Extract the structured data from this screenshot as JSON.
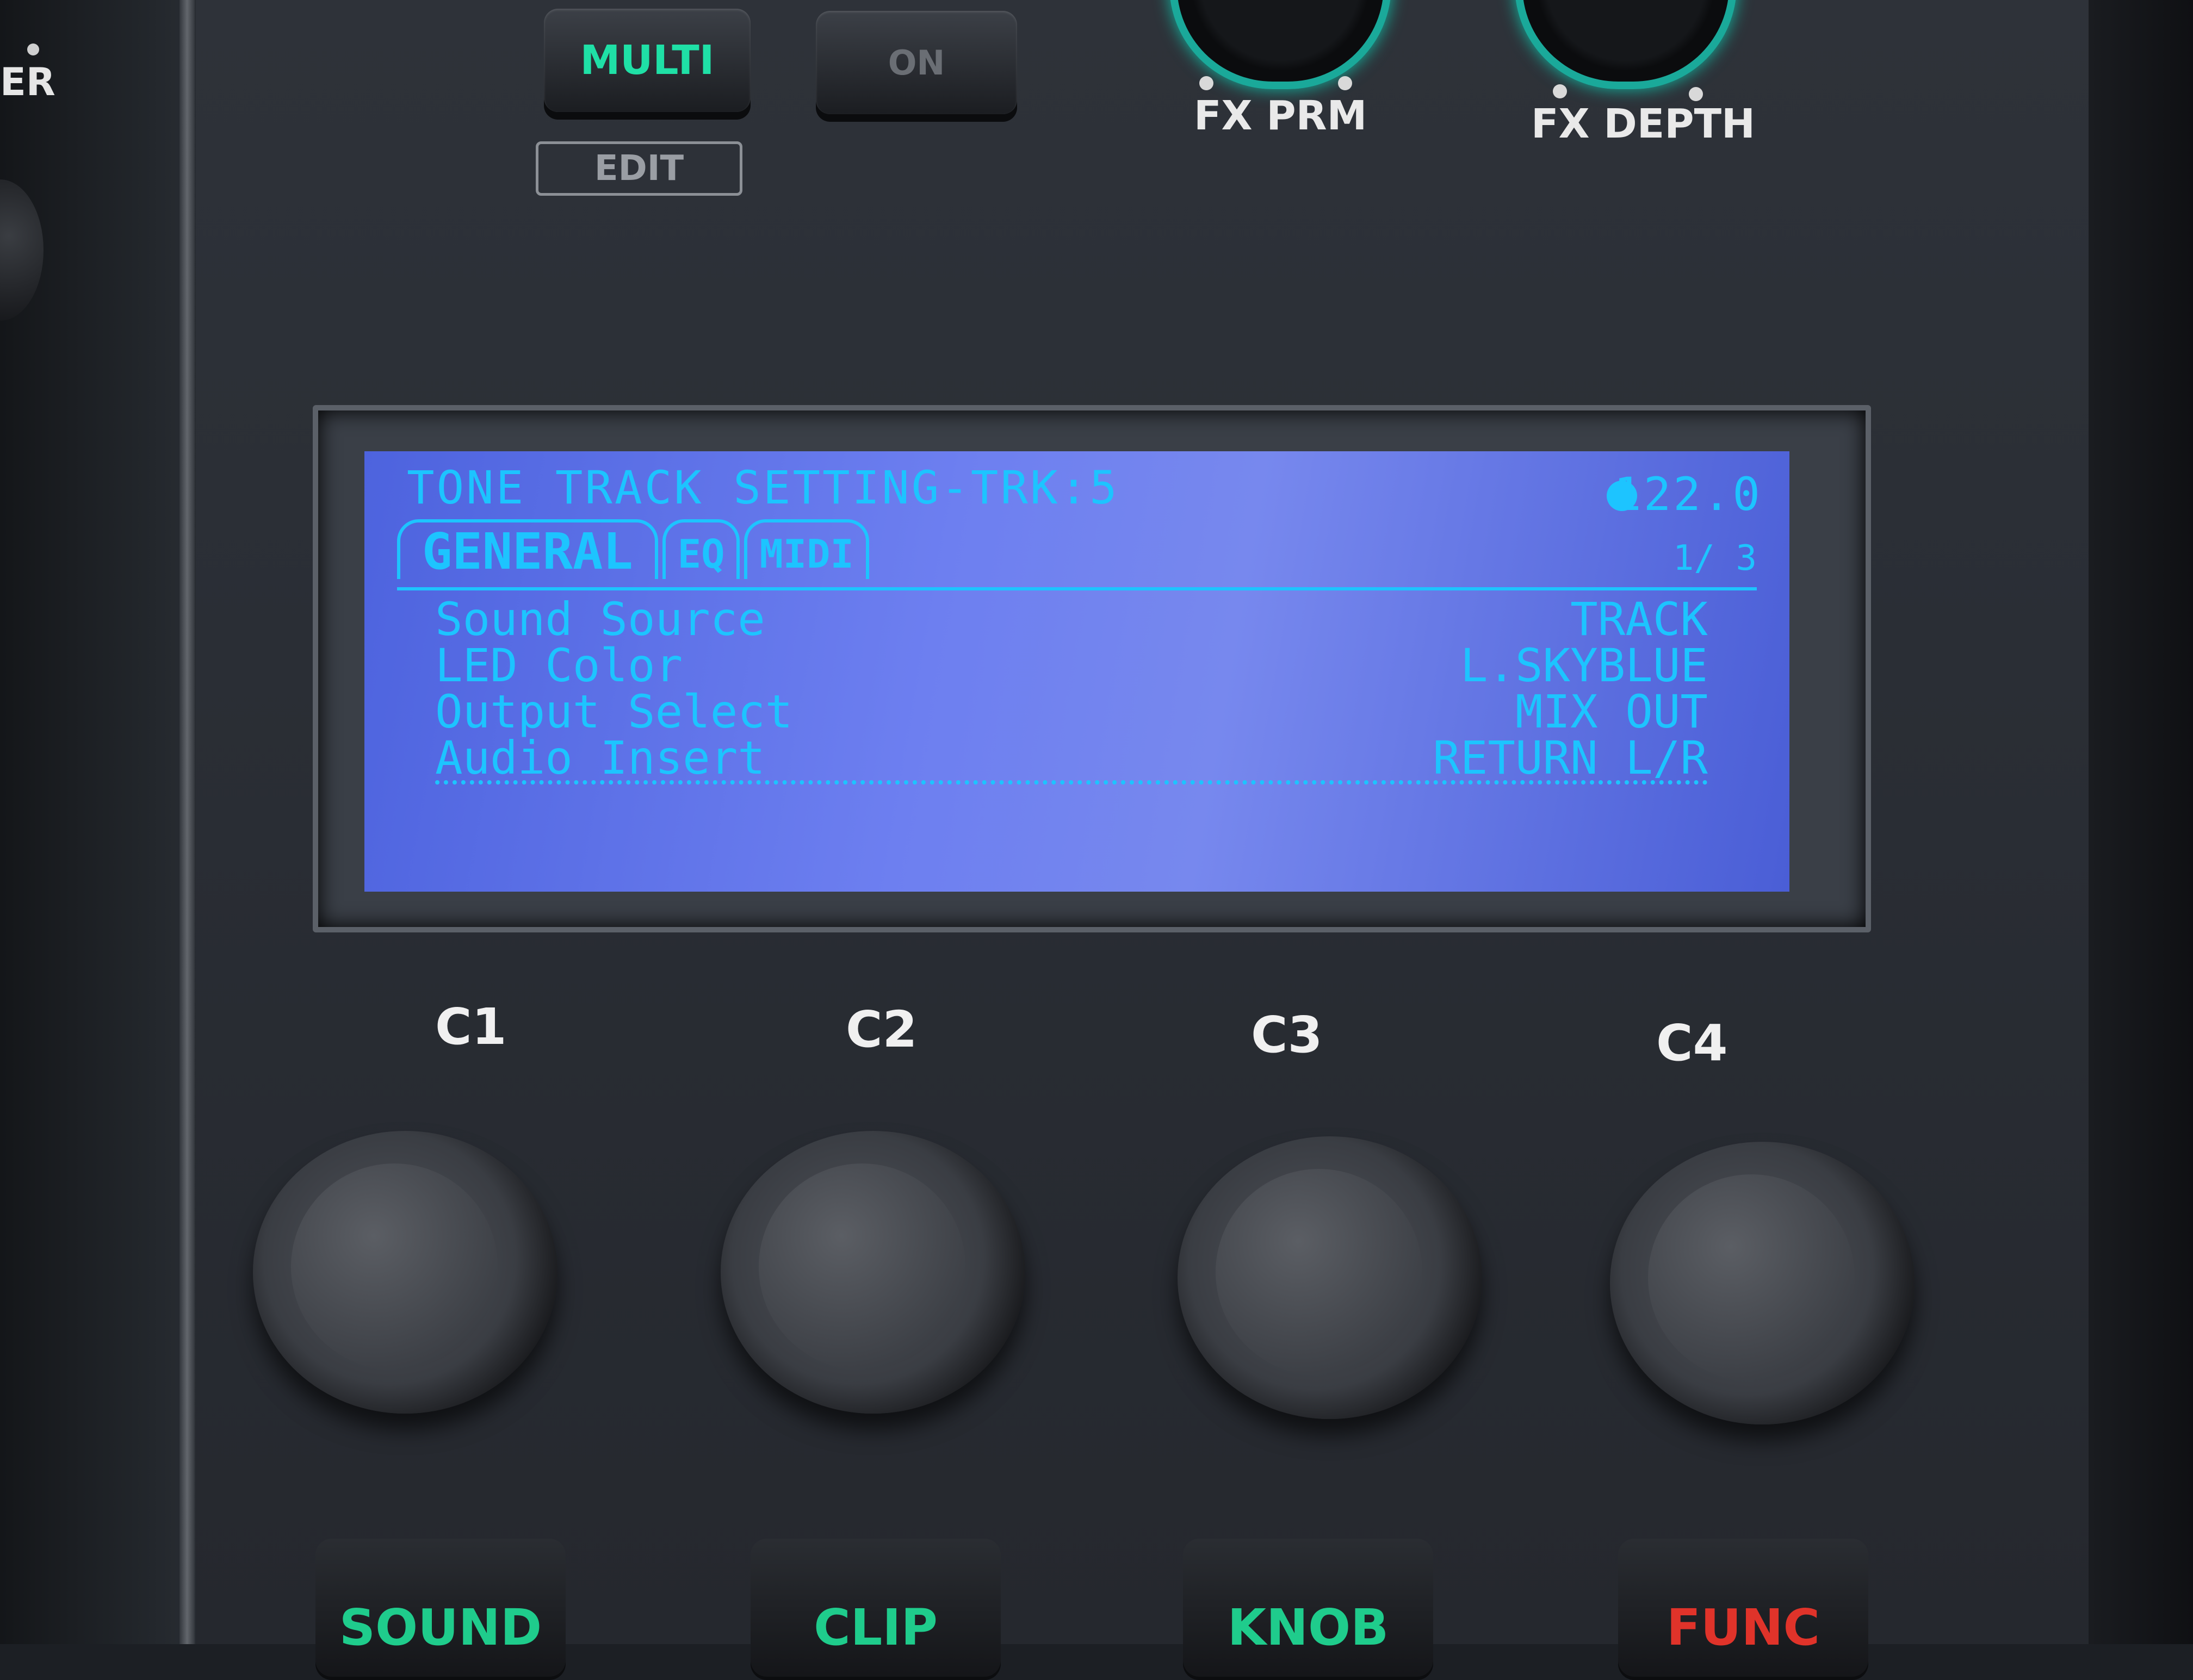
{
  "left_label": "ER",
  "buttons": {
    "multi": "MULTI",
    "on": "ON",
    "edit": "EDIT"
  },
  "fx": {
    "prm_label": "FX PRM",
    "depth_label": "FX DEPTH"
  },
  "lcd": {
    "title": "TONE TRACK SETTING-TRK:5",
    "tempo": "122.0",
    "tabs": [
      "GENERAL",
      "EQ",
      "MIDI"
    ],
    "active_tab": "GENERAL",
    "page": "1/ 3",
    "rows": [
      {
        "label": "Sound Source",
        "value": "TRACK"
      },
      {
        "label": "LED Color",
        "value": "L.SKYBLUE"
      },
      {
        "label": "Output Select",
        "value": "MIX OUT"
      },
      {
        "label": "Audio Insert",
        "value": "RETURN L/R"
      }
    ],
    "selected_row": "Audio Insert"
  },
  "knobs": [
    "C1",
    "C2",
    "C3",
    "C4"
  ],
  "pads": [
    {
      "label": "SOUND",
      "color": "#1fcc8c"
    },
    {
      "label": "CLIP",
      "color": "#1fcc8c"
    },
    {
      "label": "KNOB",
      "color": "#1fcc8c"
    },
    {
      "label": "FUNC",
      "color": "#e0332a"
    }
  ],
  "colors": {
    "lcd_text": "#1dc4ff",
    "lcd_background": "#6677e8",
    "accent_green": "#1fe0a6"
  }
}
